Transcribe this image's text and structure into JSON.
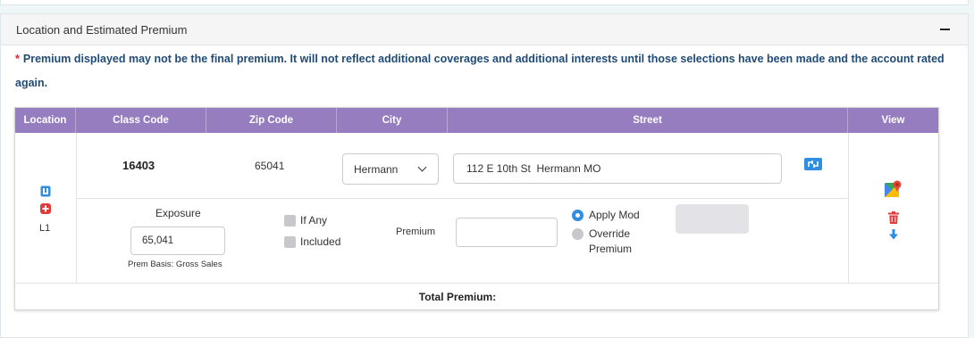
{
  "panel": {
    "title": "Location and Estimated Premium",
    "collapse_icon": "minus-icon"
  },
  "notice": {
    "star": "*",
    "text": "Premium displayed may not be the final premium. It will not reflect additional coverages and additional interests until those selections have been made and the account rated again."
  },
  "table": {
    "headers": [
      "Location",
      "Class Code",
      "Zip Code",
      "City",
      "Street",
      "View"
    ],
    "location": {
      "label": "L1",
      "icons": [
        "copy-icon",
        "add-icon"
      ]
    },
    "row": {
      "class_code": "16403",
      "zip_code": "65041",
      "city": "Hermann",
      "street": "112 E 10th St  Hermann MO",
      "street_icon": "map-edit-icon"
    },
    "exposure": {
      "label": "Exposure",
      "value": "65,041",
      "prem_basis": "Prem Basis: Gross Sales"
    },
    "checkboxes": [
      {
        "label": "If Any",
        "checked": false
      },
      {
        "label": "Included",
        "checked": false
      }
    ],
    "premium_label": "Premium",
    "premium_value": "",
    "radios": [
      {
        "label": "Apply Mod",
        "selected": true
      },
      {
        "label": "Override Premium",
        "selected": false
      }
    ],
    "view_icons": [
      "google-maps-icon",
      "trash-icon",
      "arrow-down-icon"
    ],
    "total_label": "Total Premium:"
  },
  "colors": {
    "header_bg": "#957dc0",
    "notice_text": "#1f4b78",
    "required_star": "#d9232e",
    "radio_accent": "#2f8ee0"
  }
}
